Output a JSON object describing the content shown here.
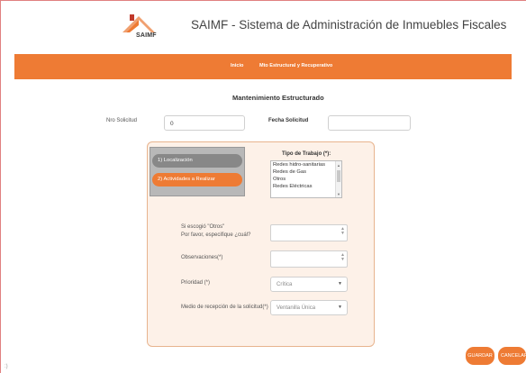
{
  "header": {
    "logo_text": "SAIMF",
    "title": "SAIMF - Sistema de Administración de Inmuebles Fiscales"
  },
  "nav": {
    "items": [
      {
        "label": "Inicio"
      },
      {
        "label": "Mto Estructural y Recuperativo"
      }
    ]
  },
  "page": {
    "section_title": "Mantenimiento Estructurado",
    "nro_solicitud_label": "Nro Solicitud",
    "nro_solicitud_value": "0",
    "fecha_solicitud_label": "Fecha Solicitud",
    "fecha_solicitud_value": ""
  },
  "tabs": [
    {
      "label": "1) Localización"
    },
    {
      "label": "2) Actividades a Realizar"
    }
  ],
  "form": {
    "tipo_trabajo_label": "Tipo de Trabajo (*):",
    "tipo_trabajo_options": [
      "Redes hidro-sanitarias",
      "Redes de Gas",
      "Otros",
      "Redes Eléctricas"
    ],
    "otros_label_line1": "Si escogió \"Otros\"",
    "otros_label_line2": "Por favor, especifique ¿cuál?",
    "otros_value": "",
    "observaciones_label": "Observaciones(*)",
    "observaciones_value": "",
    "prioridad_label": "Prioridad (*)",
    "prioridad_value": "Crítica",
    "medio_label": "Medio de recepción de la solicitud(*)",
    "medio_value": "Ventanilla Única"
  },
  "actions": {
    "save_label": "GUARDAR",
    "cancel_label": "CANCELAR"
  },
  "misc": {
    "corner_mark": ":)"
  },
  "colors": {
    "accent": "#ee7b34",
    "tab_inactive": "#888888",
    "panel_bg": "#fdf1e8"
  }
}
